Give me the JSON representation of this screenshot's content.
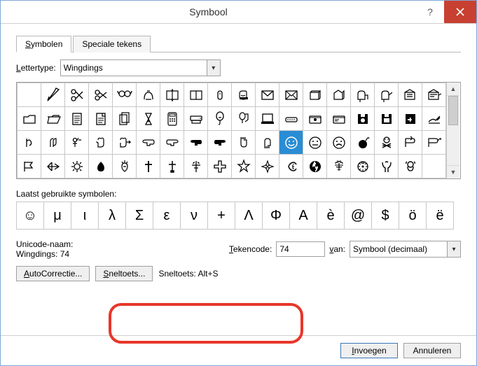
{
  "title": "Symbool",
  "tabs": {
    "symbols": "Symbolen",
    "special": "Speciale tekens"
  },
  "font_label": "Lettertype:",
  "font_value": "Wingdings",
  "recent_label": "Laatst gebruikte symbolen:",
  "recent": [
    "☺",
    "μ",
    "ι",
    "λ",
    "Σ",
    "ε",
    "ν",
    "+",
    "Λ",
    "Φ",
    "Α",
    "è",
    "@",
    "$",
    "ö",
    "ë"
  ],
  "unicode_name_label": "Unicode-naam:",
  "unicode_name_value": "Wingdings: 74",
  "charcode_label": "Tekencode:",
  "charcode_value": "74",
  "from_label": "van:",
  "from_value": "Symbool (decimaal)",
  "autocorrect_btn": "AutoCorrectie...",
  "shortcut_btn": "Sneltoets...",
  "shortcut_text": "Sneltoets: Alt+S",
  "insert_btn": "Invoegen",
  "cancel_btn": "Annuleren",
  "selected_char": "☺"
}
